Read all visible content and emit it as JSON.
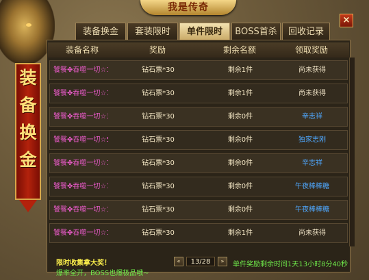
{
  "banner_title": "我是传奇",
  "close_label": "×",
  "side_banner": [
    "装",
    "备",
    "换",
    "金"
  ],
  "tabs": [
    {
      "label": "装备换金",
      "active": false
    },
    {
      "label": "套装限时",
      "active": false
    },
    {
      "label": "单件限时",
      "active": true
    },
    {
      "label": "BOSS首杀",
      "active": false
    },
    {
      "label": "回收记录",
      "active": false
    }
  ],
  "table": {
    "headers": [
      "装备名称",
      "奖励",
      "剩余名额",
      "领取奖励"
    ],
    "rows": [
      {
        "name": "饕餮✤吞噬一切☆1",
        "reward": "钻石票*30",
        "remaining": "剩余1件",
        "status": "尚未获得",
        "status_type": "none"
      },
      {
        "name": "饕餮✤吞噬一切☆1",
        "reward": "钻石票*30",
        "remaining": "剩余1件",
        "status": "尚未获得",
        "status_type": "none"
      },
      {
        "name": "饕餮✤吞噬一切☆3",
        "reward": "钻石票*30",
        "remaining": "剩余0件",
        "status": "辛志祥",
        "status_type": "name"
      },
      {
        "name": "饕餮✤吞噬一切☆5",
        "reward": "钻石票*30",
        "remaining": "剩余0件",
        "status": "独家志刚",
        "status_type": "name"
      },
      {
        "name": "饕餮✤吞噬一切☆1",
        "reward": "钻石票*30",
        "remaining": "剩余0件",
        "status": "辛志祥",
        "status_type": "name"
      },
      {
        "name": "饕餮✤吞噬一切☆1",
        "reward": "钻石票*30",
        "remaining": "剩余0件",
        "status": "午夜棒棒糖",
        "status_type": "name"
      },
      {
        "name": "饕餮✤吞噬一切☆1",
        "reward": "钻石票*30",
        "remaining": "剩余0件",
        "status": "午夜棒棒糖",
        "status_type": "name"
      },
      {
        "name": "饕餮✤吞噬一切☆1",
        "reward": "钻石票*30",
        "remaining": "剩余1件",
        "status": "尚未获得",
        "status_type": "none"
      }
    ]
  },
  "footer": {
    "line1": "限时收集拿大奖！",
    "line2": "爆率全开，BOSS也爆极品哦~",
    "page": "13/28",
    "prev_label": "«",
    "next_label": "»",
    "countdown": "单件奖励剩余时间1天13小时8分40秒"
  },
  "colors": {
    "name_text": "#e85ac8",
    "player_name": "#4fa8ff",
    "footer_green": "#6ee84a",
    "footer_yellow": "#f6e94a"
  }
}
